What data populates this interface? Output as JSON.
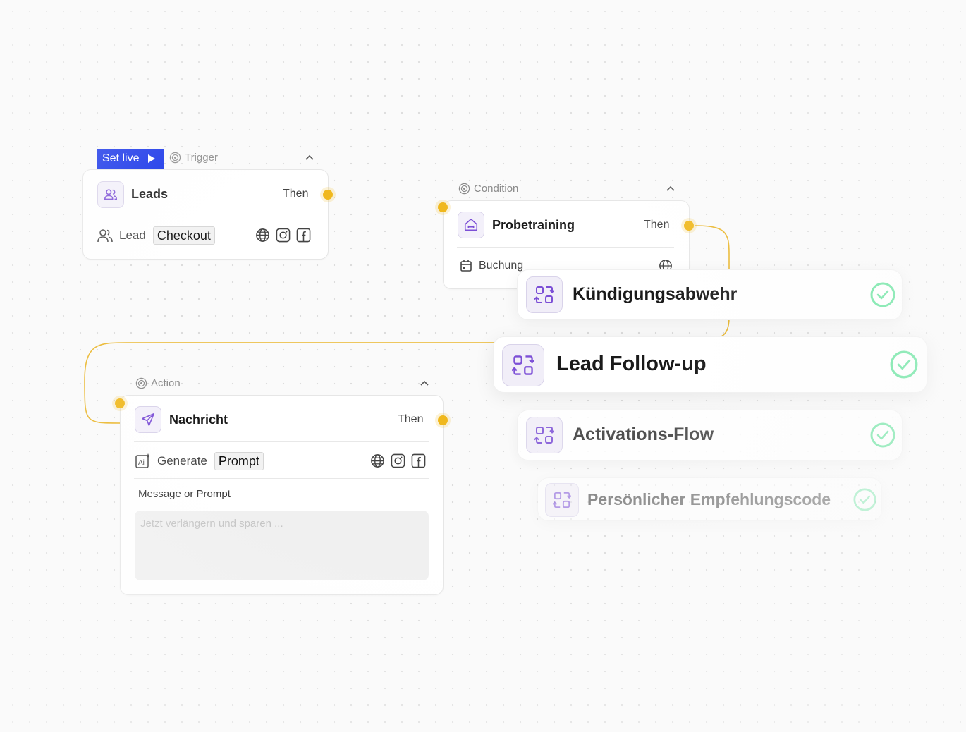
{
  "set_live": {
    "label": "Set live"
  },
  "trigger": {
    "header": "Trigger",
    "title": "Leads",
    "then": "Then",
    "source_label": "Lead",
    "tag": "Checkout",
    "channels": [
      "globe-icon",
      "instagram-icon",
      "facebook-icon"
    ]
  },
  "condition": {
    "header": "Condition",
    "title": "Probetraining",
    "then": "Then",
    "row_label": "Buchung"
  },
  "action": {
    "header": "Action",
    "title": "Nachricht",
    "then": "Then",
    "generate_label": "Generate",
    "tag": "Prompt",
    "message_label": "Message or Prompt",
    "placeholder": "Jetzt verlängern und sparen ..."
  },
  "flows": [
    {
      "name": "Kündigungsabwehr",
      "status": "check-icon"
    },
    {
      "name": "Lead Follow-up",
      "status": "check-icon"
    },
    {
      "name": "Activations-Flow",
      "status": "check-icon"
    },
    {
      "name": "Persönlicher Empfehlungscode",
      "status": "check-icon"
    }
  ],
  "colors": {
    "accent_blue": "#0d2be8",
    "port_yellow": "#f0b81d",
    "icon_purple": "#7c4fd6",
    "check_green": "#5fe39a"
  }
}
